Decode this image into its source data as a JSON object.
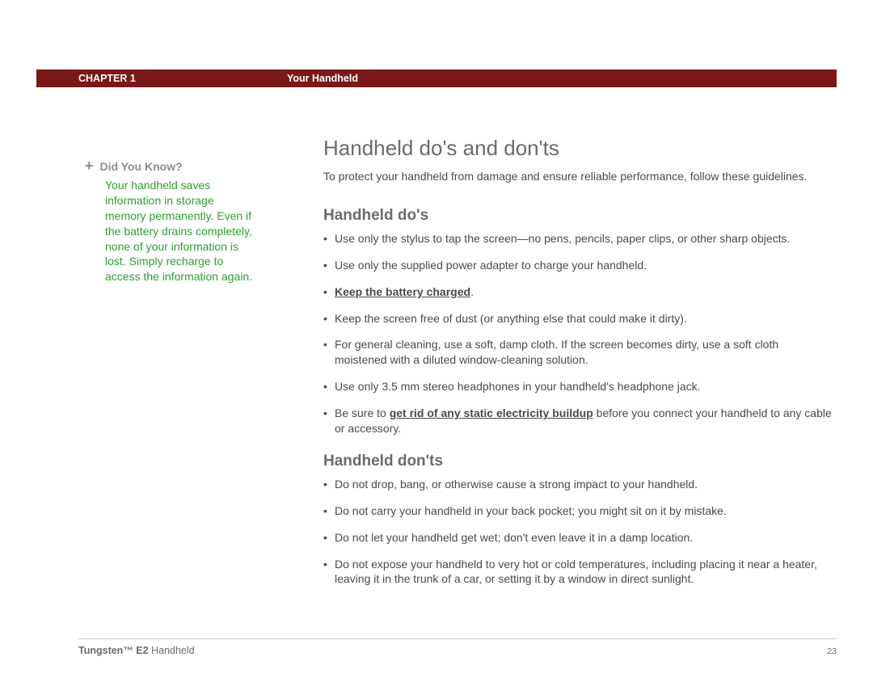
{
  "header": {
    "chapter": "CHAPTER 1",
    "title": "Your Handheld"
  },
  "sidebar": {
    "heading": "Did You Know?",
    "body": "Your handheld saves information in storage memory permanently. Even if the battery drains completely, none of your information is lost. Simply recharge to access the information again."
  },
  "main": {
    "title": "Handheld do's and don'ts",
    "intro": "To protect your handheld from damage and ensure reliable performance, follow these guidelines.",
    "dos_heading": "Handheld do's",
    "dos": {
      "b1": "Use only the stylus to tap the screen—no pens, pencils, paper clips, or other sharp objects.",
      "b2": "Use only the supplied power adapter to charge your handheld.",
      "b3_link": "Keep the battery charged",
      "b3_after": ".",
      "b4": "Keep the screen free of dust (or anything else that could make it dirty).",
      "b5": "For general cleaning, use a soft, damp cloth. If the screen becomes dirty, use a soft cloth moistened with a diluted window-cleaning solution.",
      "b6": "Use only 3.5 mm stereo headphones in your handheld's headphone jack.",
      "b7_before": "Be sure to ",
      "b7_link": "get rid of any static electricity buildup",
      "b7_after": " before you connect your handheld to any cable or accessory."
    },
    "donts_heading": "Handheld don'ts",
    "donts": {
      "b1": "Do not drop, bang, or otherwise cause a strong impact to your handheld.",
      "b2": "Do not carry your handheld in your back pocket; you might sit on it by mistake.",
      "b3": "Do not let your handheld get wet; don't even leave it in a damp location.",
      "b4": "Do not expose your handheld to very hot or cold temperatures, including placing it near a heater, leaving it in the trunk of a car, or setting it by a window in direct sunlight."
    }
  },
  "footer": {
    "model_bold": "Tungsten™ E2",
    "model_rest": " Handheld",
    "page": "23"
  }
}
